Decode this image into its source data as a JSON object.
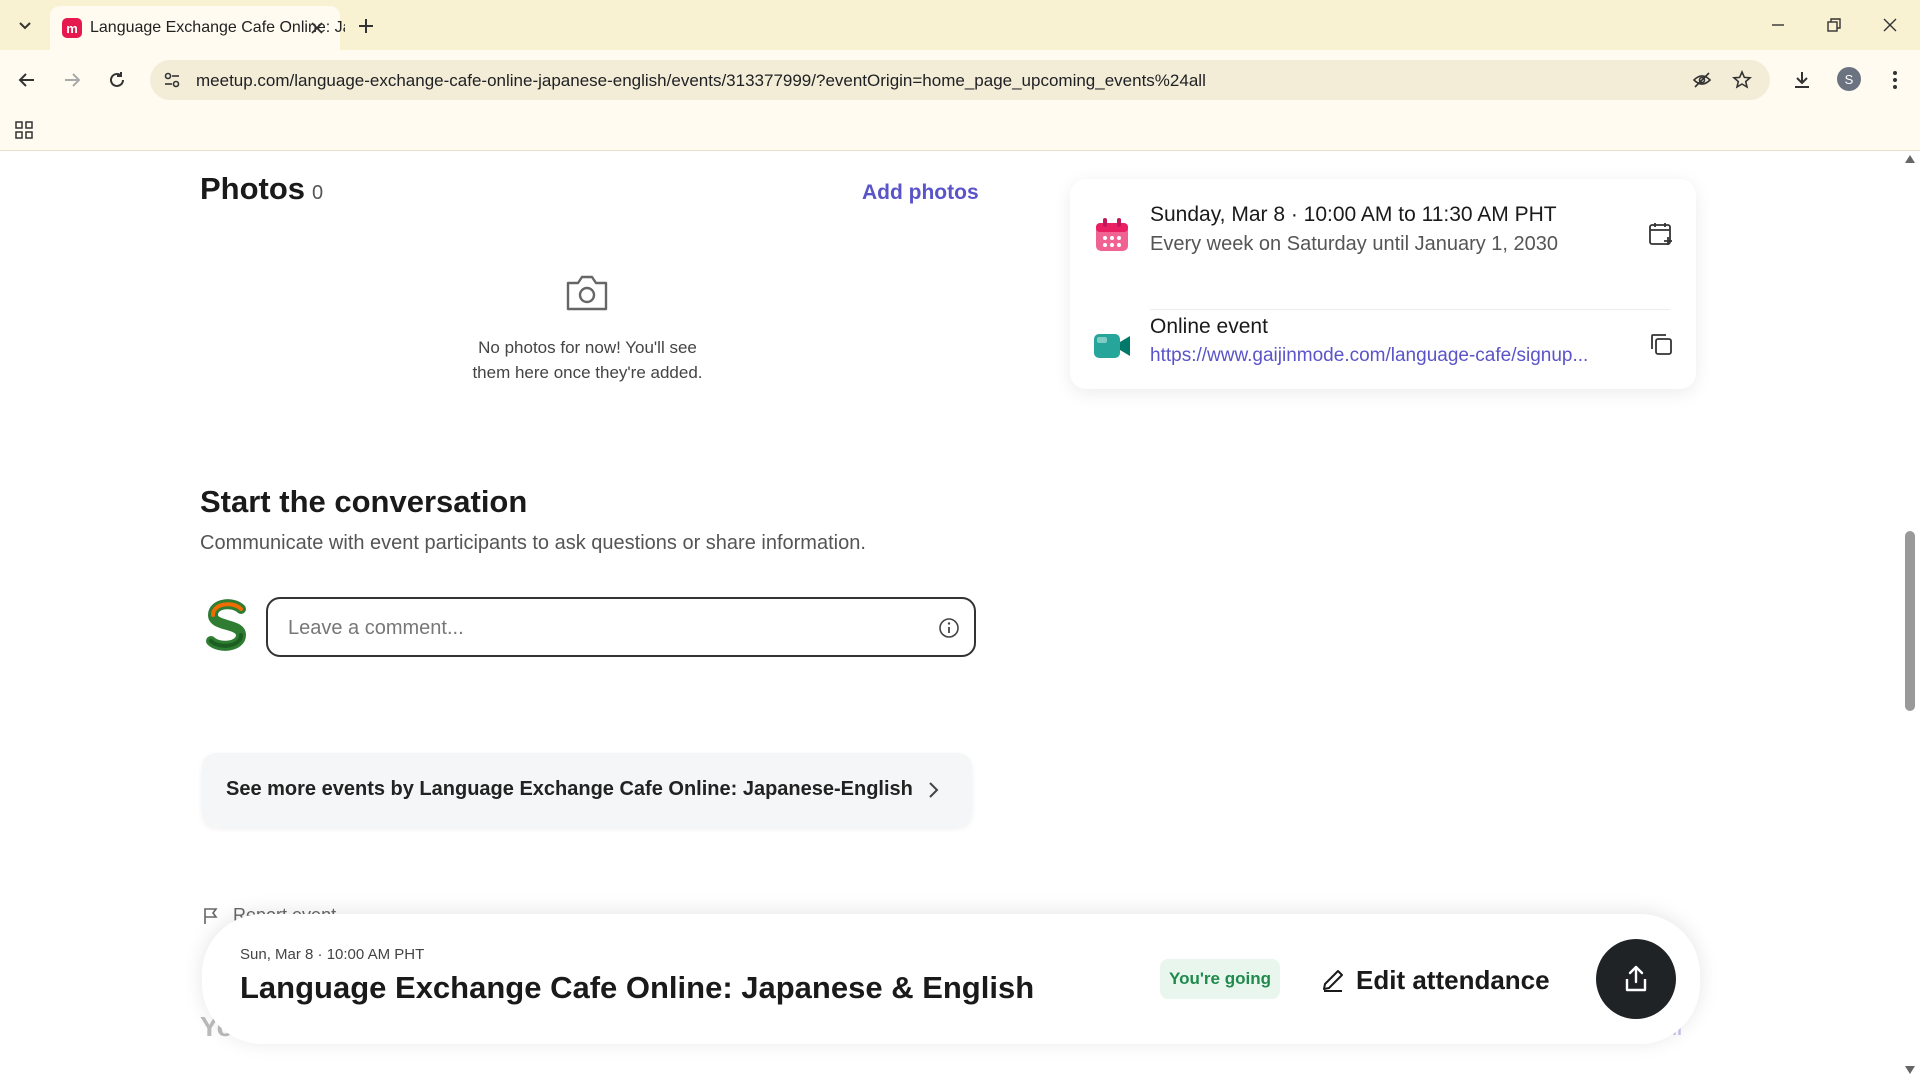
{
  "browser": {
    "tab_title": "Language Exchange Cafe Online: Japanese-English",
    "favicon_letter": "m",
    "url": "meetup.com/language-exchange-cafe-online-japanese-english/events/313377999/?eventOrigin=home_page_upcoming_events%24all",
    "profile_initial": "S"
  },
  "photos": {
    "title": "Photos",
    "count": "0",
    "add_label": "Add photos",
    "empty_line1": "No photos for now! You'll see",
    "empty_line2": "them here once they're added."
  },
  "conversation": {
    "title": "Start the conversation",
    "subtitle": "Communicate with event participants to ask questions or share information.",
    "comment_placeholder": "Leave a comment..."
  },
  "see_more": {
    "label": "See more events by Language Exchange Cafe Online: Japanese-English"
  },
  "report": {
    "label": "Report event"
  },
  "info_card": {
    "date_line": "Sunday, Mar 8 · 10:00 AM to 11:30 AM PHT",
    "recurrence": "Every week on Saturday until January 1, 2030",
    "location_label": "Online event",
    "link": "https://www.gaijinmode.com/language-cafe/signup..."
  },
  "sticky_bar": {
    "date": "Sun, Mar 8 · 10:00 AM PHT",
    "title": "Language Exchange Cafe Online: Japanese & English",
    "going_badge": "You're going",
    "edit_label": "Edit attendance"
  },
  "colors": {
    "brand_link": "#5a54c8",
    "going_bg": "#e8f6ee",
    "going_text": "#1f8a4c",
    "share_bg": "#1f2326",
    "chrome_bg": "#f8f1d2"
  }
}
